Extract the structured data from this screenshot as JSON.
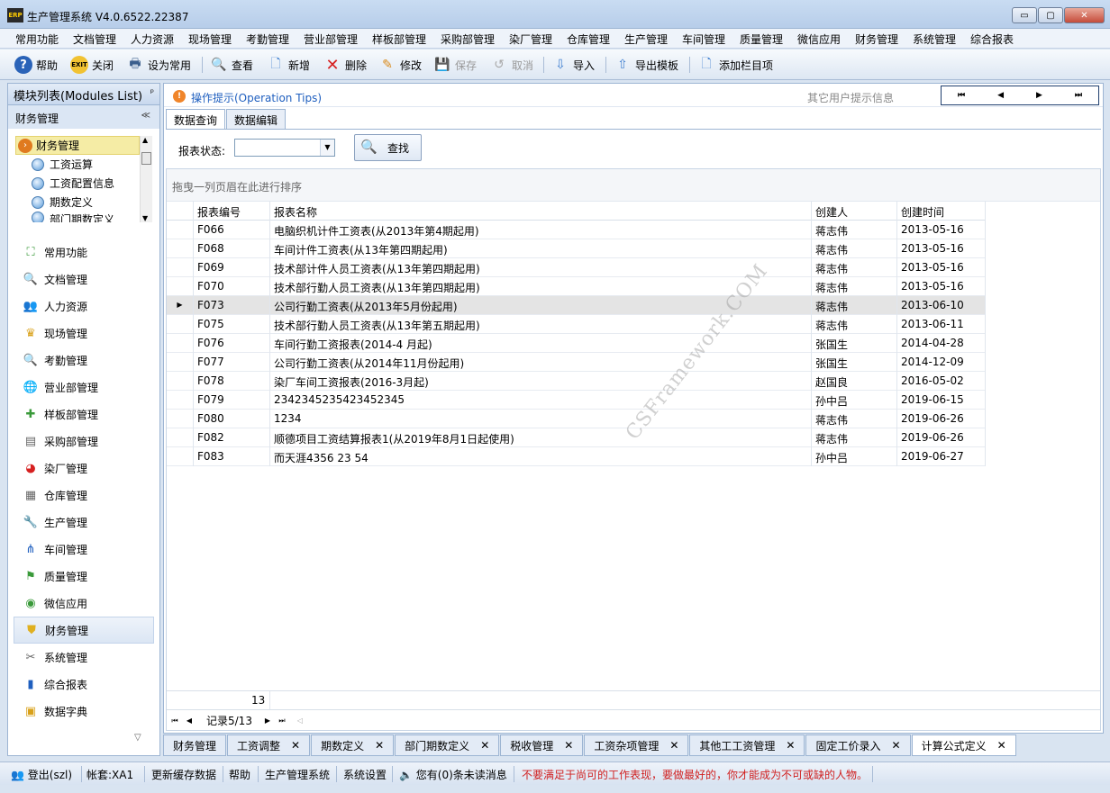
{
  "window": {
    "logo_text": "ERP",
    "title": "生产管理系统 V4.0.6522.22387",
    "minimize": "▭",
    "maximize": "▢",
    "close": "✕"
  },
  "menu": [
    "常用功能",
    "文档管理",
    "人力资源",
    "现场管理",
    "考勤管理",
    "营业部管理",
    "样板部管理",
    "采购部管理",
    "染厂管理",
    "仓库管理",
    "生产管理",
    "车间管理",
    "质量管理",
    "微信应用",
    "财务管理",
    "系统管理",
    "综合报表"
  ],
  "toolbar": {
    "help": "帮助",
    "close": "关闭",
    "set_common": "设为常用",
    "view": "查看",
    "add": "新增",
    "delete": "删除",
    "edit": "修改",
    "save": "保存",
    "cancel": "取消",
    "import": "导入",
    "export_template": "导出模板",
    "add_column": "添加栏目项"
  },
  "left_panel": {
    "title": "模块列表(Modules List)",
    "pin": "ᵖ",
    "group_title": "财务管理",
    "collapse": "≪",
    "tree": {
      "root": "财务管理",
      "children": [
        "工资运算",
        "工资配置信息",
        "期数定义",
        "部门期数定义"
      ]
    },
    "nav": [
      {
        "label": "常用功能",
        "icon": "⛶"
      },
      {
        "label": "文档管理",
        "icon": "🔍"
      },
      {
        "label": "人力资源",
        "icon": "👥"
      },
      {
        "label": "现场管理",
        "icon": "♛"
      },
      {
        "label": "考勤管理",
        "icon": "🔍"
      },
      {
        "label": "营业部管理",
        "icon": "🌐"
      },
      {
        "label": "样板部管理",
        "icon": "✚"
      },
      {
        "label": "采购部管理",
        "icon": "▤"
      },
      {
        "label": "染厂管理",
        "icon": "◕"
      },
      {
        "label": "仓库管理",
        "icon": "▦"
      },
      {
        "label": "生产管理",
        "icon": "🔧"
      },
      {
        "label": "车间管理",
        "icon": "⋔"
      },
      {
        "label": "质量管理",
        "icon": "⚑"
      },
      {
        "label": "微信应用",
        "icon": "◉"
      },
      {
        "label": "财务管理",
        "icon": "⛊"
      },
      {
        "label": "系统管理",
        "icon": "✂"
      },
      {
        "label": "综合报表",
        "icon": "▮"
      },
      {
        "label": "数据字典",
        "icon": "▣"
      }
    ],
    "scroll_down": "▽"
  },
  "tips": {
    "icon": "!",
    "text": "操作提示(Operation Tips)",
    "other": "其它用户提示信息",
    "pager": [
      "⏮",
      "◀",
      "▶",
      "⏭"
    ]
  },
  "tabs": [
    "数据查询",
    "数据编辑"
  ],
  "filter": {
    "label": "报表状态:",
    "value": "",
    "search": "查找"
  },
  "grid": {
    "group_hint": "拖曳一列页眉在此进行排序",
    "columns": [
      "报表编号",
      "报表名称",
      "创建人",
      "创建时间"
    ],
    "rows": [
      [
        "F066",
        "电脑织机计件工资表(从2013年第4期起用)",
        "蒋志伟",
        "2013-05-16"
      ],
      [
        "F068",
        "车间计件工资表(从13年第四期起用)",
        "蒋志伟",
        "2013-05-16"
      ],
      [
        "F069",
        "技术部计件人员工资表(从13年第四期起用)",
        "蒋志伟",
        "2013-05-16"
      ],
      [
        "F070",
        "技术部行勤人员工资表(从13年第四期起用)",
        "蒋志伟",
        "2013-05-16"
      ],
      [
        "F073",
        "公司行勤工资表(从2013年5月份起用)",
        "蒋志伟",
        "2013-06-10"
      ],
      [
        "F075",
        "技术部行勤人员工资表(从13年第五期起用)",
        "蒋志伟",
        "2013-06-11"
      ],
      [
        "F076",
        "车间行勤工资报表(2014-4 月起)",
        "张国生",
        "2014-04-28"
      ],
      [
        "F077",
        "公司行勤工资表(从2014年11月份起用)",
        "张国生",
        "2014-12-09"
      ],
      [
        "F078",
        "染厂车间工资报表(2016-3月起)",
        "赵国良",
        "2016-05-02"
      ],
      [
        "F079",
        "2342345235423452345",
        "孙中吕",
        "2019-06-15"
      ],
      [
        "F080",
        "1234",
        "蒋志伟",
        "2019-06-26"
      ],
      [
        "F082",
        "顺德项目工资结算报表1(从2019年8月1日起使用)",
        "蒋志伟",
        "2019-06-26"
      ],
      [
        "F083",
        "而天涯4356 23 54",
        "孙中吕",
        "2019-06-27"
      ]
    ],
    "selected_index": 4,
    "row_indicator": "▶",
    "footer_count": "13",
    "record_text": "记录5/13",
    "nav_first": "⏮",
    "nav_prev": "◀",
    "nav_next": "▶",
    "nav_last": "⏭",
    "nav_extra": "◁"
  },
  "watermark": "CSFramework.COM",
  "bottom_tabs": [
    {
      "label": "财务管理",
      "closable": false
    },
    {
      "label": "工资调整",
      "closable": true
    },
    {
      "label": "期数定义",
      "closable": true
    },
    {
      "label": "部门期数定义",
      "closable": true
    },
    {
      "label": "税收管理",
      "closable": true
    },
    {
      "label": "工资杂项管理",
      "closable": true
    },
    {
      "label": "其他工工资管理",
      "closable": true
    },
    {
      "label": "固定工价录入",
      "closable": true
    },
    {
      "label": "计算公式定义",
      "closable": true
    }
  ],
  "close_glyph": "✕",
  "status": {
    "logout": "登出(szl)",
    "account": "帐套:XA1",
    "refresh_cache": "更新缓存数据",
    "help": "帮助",
    "system": "生产管理系统",
    "settings": "系统设置",
    "messages": "您有(0)条未读消息",
    "motto": "不要满足于尚可的工作表现，要做最好的，你才能成为不可或缺的人物。"
  }
}
